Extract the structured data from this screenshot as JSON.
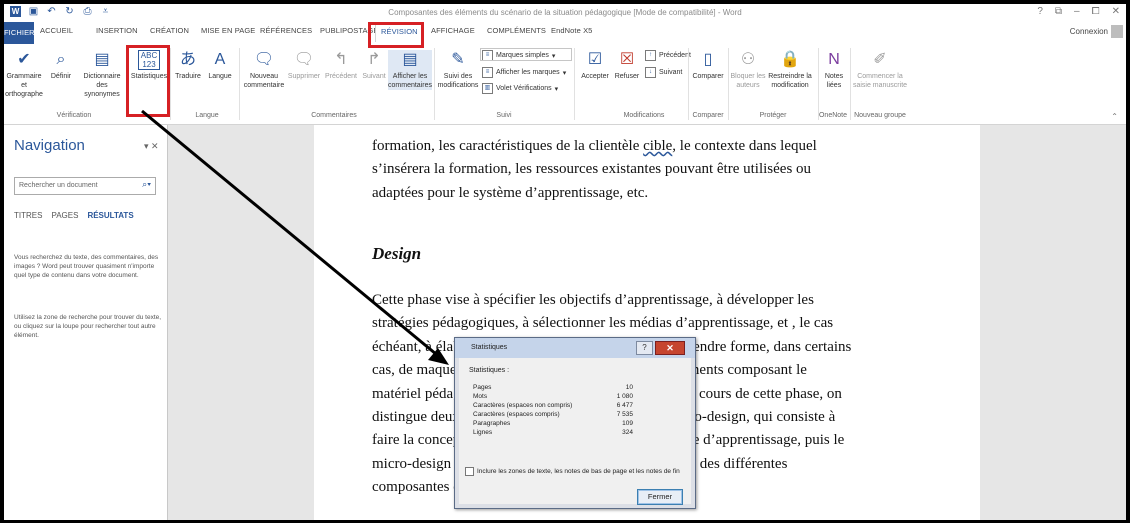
{
  "window": {
    "title": "Composantes des éléments du scénario de la situation pédagogique [Mode de compatibilité] - Word",
    "controls": [
      "?",
      "⧉",
      "–",
      "⧠",
      "✕"
    ]
  },
  "tabs": {
    "fichier": "FICHIER",
    "accueil": "ACCUEIL",
    "insertion": "INSERTION",
    "creation": "CRÉATION",
    "mise_en_page": "MISE EN PAGE",
    "references": "RÉFÉRENCES",
    "publipostage": "PUBLIPOSTAGE",
    "revision": "RÉVISION",
    "affichage": "AFFICHAGE",
    "complements": "COMPLÉMENTS",
    "endnote": "EndNote X5",
    "connexion": "Connexion"
  },
  "ribbon": {
    "grammaire": [
      "Grammaire et",
      "orthographe"
    ],
    "definir": "Définir",
    "dictionnaire": [
      "Dictionnaire",
      "des synonymes"
    ],
    "statistiques": "Statistiques",
    "traduire": "Traduire",
    "langue": "Langue",
    "nouveau_commentaire": [
      "Nouveau",
      "commentaire"
    ],
    "supprimer": "Supprimer",
    "precedent_comment": "Précédent",
    "suivant_comment": "Suivant",
    "afficher_commentaires": [
      "Afficher les",
      "commentaires"
    ],
    "suivi_modifications": [
      "Suivi des",
      "modifications"
    ],
    "marques_simples": "Marques simples",
    "afficher_marques": "Afficher les marques",
    "volet_verifications": "Volet Vérifications",
    "accepter": "Accepter",
    "refuser": "Refuser",
    "precedent": "Précédent",
    "suivant": "Suivant",
    "comparer": "Comparer",
    "bloquer": [
      "Bloquer les",
      "auteurs"
    ],
    "restreindre": [
      "Restreindre la",
      "modification"
    ],
    "notes_liees": [
      "Notes",
      "liées"
    ],
    "commencer": [
      "Commencer la",
      "saisie manuscrite"
    ],
    "groups": {
      "verification": "Vérification",
      "langue": "Langue",
      "commentaires": "Commentaires",
      "suivi": "Suivi",
      "modifications": "Modifications",
      "comparer": "Comparer",
      "proteger": "Protéger",
      "onenote": "OneNote",
      "nouveau_groupe": "Nouveau groupe"
    }
  },
  "nav": {
    "title": "Navigation",
    "search_placeholder": "Rechercher un document",
    "tabs": [
      "TITRES",
      "PAGES",
      "RÉSULTATS"
    ],
    "info1": "Vous recherchez du texte, des commentaires, des images ? Word peut trouver quasiment n'importe quel type de contenu dans votre document.",
    "info2": "Utilisez la zone de recherche pour trouver du texte, ou cliquez sur la loupe pour rechercher tout autre élément."
  },
  "document": {
    "para1_pre": "formation, les caractéristiques de la clientèle ",
    "para1_cible": "cible",
    "para1_post": ", le contexte dans lequel s’insérera la formation, les ressources existantes pouvant être utilisées ou adaptées pour le système d’apprentissage, etc.",
    "heading": "Design",
    "para2": "Cette phase vise à spécifier les objectifs d’apprentissage, à développer les stratégies pédagogiques, à sélectionner les médias d’apprentissage, et , le cas échéant, à élaborer les éléments qui permettront de prendre forme, dans certains cas, de maquettes, de prototypes qui illustrent les éléments composant le matériel pédagogique du système d’apprentissage. Au cours de cette phase, on distingue deux niveaux de design : d’une part, le micro-design, qui consiste à faire la conception de chacun des éléments du système d’apprentissage, puis le micro-design qui consiste à faire le design de chacune des différentes composantes du système d’apprentissage."
  },
  "dialog": {
    "title": "Statistiques",
    "section": "Statistiques :",
    "rows": [
      {
        "label": "Pages",
        "value": "10"
      },
      {
        "label": "Mots",
        "value": "1 080"
      },
      {
        "label": "Caractères (espaces non compris)",
        "value": "6 477"
      },
      {
        "label": "Caractères (espaces compris)",
        "value": "7 535"
      },
      {
        "label": "Paragraphes",
        "value": "109"
      },
      {
        "label": "Lignes",
        "value": "324"
      }
    ],
    "checkbox": "Inclure les zones de texte, les notes de bas de page et les notes de fin",
    "close": "Fermer",
    "help": "?",
    "close_x": "✕"
  },
  "colors": {
    "accent": "#2b579a",
    "highlight_box": "#d62024"
  }
}
